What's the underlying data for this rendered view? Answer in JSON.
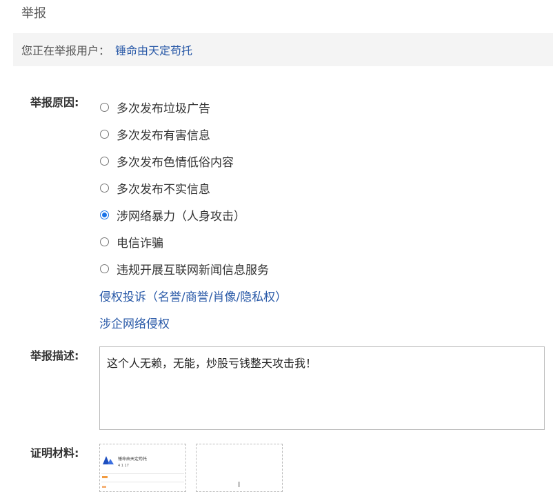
{
  "page": {
    "title": "举报"
  },
  "target": {
    "prefix": "您正在举报用户：",
    "username": "锤命由天定苟托"
  },
  "reason": {
    "label": "举报原因:",
    "options": [
      {
        "label": "多次发布垃圾广告",
        "checked": false
      },
      {
        "label": "多次发布有害信息",
        "checked": false
      },
      {
        "label": "多次发布色情低俗内容",
        "checked": false
      },
      {
        "label": "多次发布不实信息",
        "checked": false
      },
      {
        "label": "涉网络暴力（人身攻击）",
        "checked": true
      },
      {
        "label": "电信诈骗",
        "checked": false
      },
      {
        "label": "违规开展互联网新闻信息服务",
        "checked": false
      }
    ],
    "links": [
      {
        "label": "侵权投诉（名誉/商誉/肖像/隐私权）"
      },
      {
        "label": "涉企网络侵权"
      }
    ]
  },
  "description": {
    "label": "举报描述:",
    "value": "这个人无赖，无能，炒股亏钱整天攻击我！"
  },
  "evidence": {
    "label": "证明材料:",
    "thumb": {
      "name": "锤命由天定苟托",
      "sub": "关注 · 粉丝",
      "stats": "4  1  17"
    }
  },
  "colors": {
    "accent": "#1a73e8",
    "link": "#2a5aa8",
    "bar": "#f4f4f4"
  }
}
